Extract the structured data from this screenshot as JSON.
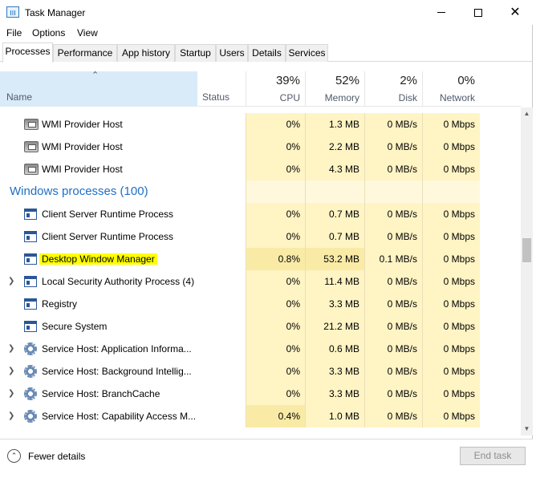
{
  "window": {
    "title": "Task Manager"
  },
  "menu": [
    "File",
    "Options",
    "View"
  ],
  "tabs": [
    "Processes",
    "Performance",
    "App history",
    "Startup",
    "Users",
    "Details",
    "Services"
  ],
  "columns": {
    "name": "Name",
    "status": "Status",
    "cpu": {
      "label": "CPU",
      "pct": "39%"
    },
    "memory": {
      "label": "Memory",
      "pct": "52%"
    },
    "disk": {
      "label": "Disk",
      "pct": "2%"
    },
    "network": {
      "label": "Network",
      "pct": "0%"
    }
  },
  "rows": [
    {
      "type": "process",
      "icon": "wmi-icon",
      "expander": false,
      "name": "WMI Provider Host",
      "cpu": "0%",
      "memory": "1.3 MB",
      "disk": "0 MB/s",
      "network": "0 Mbps"
    },
    {
      "type": "process",
      "icon": "wmi-icon",
      "expander": false,
      "name": "WMI Provider Host",
      "cpu": "0%",
      "memory": "2.2 MB",
      "disk": "0 MB/s",
      "network": "0 Mbps"
    },
    {
      "type": "process",
      "icon": "wmi-icon",
      "expander": false,
      "name": "WMI Provider Host",
      "cpu": "0%",
      "memory": "4.3 MB",
      "disk": "0 MB/s",
      "network": "0 Mbps"
    },
    {
      "type": "group",
      "name": "Windows processes (100)"
    },
    {
      "type": "process",
      "icon": "window-icon",
      "expander": false,
      "name": "Client Server Runtime Process",
      "cpu": "0%",
      "memory": "0.7 MB",
      "disk": "0 MB/s",
      "network": "0 Mbps"
    },
    {
      "type": "process",
      "icon": "window-icon",
      "expander": false,
      "name": "Client Server Runtime Process",
      "cpu": "0%",
      "memory": "0.7 MB",
      "disk": "0 MB/s",
      "network": "0 Mbps"
    },
    {
      "type": "process",
      "icon": "window-icon",
      "expander": false,
      "name": "Desktop Window Manager",
      "highlight": true,
      "cpu": "0.8%",
      "memory": "53.2 MB",
      "disk": "0.1 MB/s",
      "network": "0 Mbps",
      "cpuHot": true
    },
    {
      "type": "process",
      "icon": "window-icon",
      "expander": true,
      "name": "Local Security Authority Process (4)",
      "cpu": "0%",
      "memory": "11.4 MB",
      "disk": "0 MB/s",
      "network": "0 Mbps"
    },
    {
      "type": "process",
      "icon": "window-icon",
      "expander": false,
      "name": "Registry",
      "cpu": "0%",
      "memory": "3.3 MB",
      "disk": "0 MB/s",
      "network": "0 Mbps"
    },
    {
      "type": "process",
      "icon": "window-icon",
      "expander": false,
      "name": "Secure System",
      "cpu": "0%",
      "memory": "21.2 MB",
      "disk": "0 MB/s",
      "network": "0 Mbps"
    },
    {
      "type": "process",
      "icon": "gear-icon",
      "expander": true,
      "name": "Service Host: Application Informa...",
      "cpu": "0%",
      "memory": "0.6 MB",
      "disk": "0 MB/s",
      "network": "0 Mbps"
    },
    {
      "type": "process",
      "icon": "gear-icon",
      "expander": true,
      "name": "Service Host: Background Intellig...",
      "cpu": "0%",
      "memory": "3.3 MB",
      "disk": "0 MB/s",
      "network": "0 Mbps"
    },
    {
      "type": "process",
      "icon": "gear-icon",
      "expander": true,
      "name": "Service Host: BranchCache",
      "cpu": "0%",
      "memory": "3.3 MB",
      "disk": "0 MB/s",
      "network": "0 Mbps"
    },
    {
      "type": "process",
      "icon": "gear-icon",
      "expander": true,
      "name": "Service Host: Capability Access M...",
      "cpu": "0.4%",
      "memory": "1.0 MB",
      "disk": "0 MB/s",
      "network": "0 Mbps",
      "cpuHot": true
    }
  ],
  "footer": {
    "fewer_details": "Fewer details",
    "end_task": "End task"
  },
  "colors": {
    "accent": "#1e6fc5",
    "heat_light": "#fff4c4",
    "heat_mid": "#f9eba6",
    "highlight": "#ffff00",
    "header_sort": "#d9ebf9"
  }
}
